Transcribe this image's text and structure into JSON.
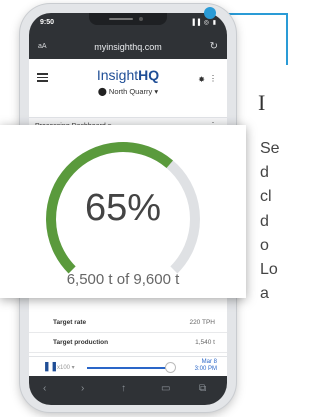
{
  "status_bar": {
    "time": "9:50",
    "icons": "▐▐ ◎ ▮"
  },
  "browser": {
    "text_size_label": "aA",
    "url": "myinsighthq.com",
    "reload_icon": "reload-icon"
  },
  "app": {
    "brand_plain": "Insight",
    "brand_bold": "HQ",
    "location": "North Quarry",
    "menu_icon": "hamburger-menu-icon",
    "bug_icon": "bug-icon"
  },
  "dashboard": {
    "title": "Processing Dashboard ▾",
    "more": "⋮"
  },
  "metrics": [
    {
      "label": "Target rate",
      "value": "220 TPH"
    },
    {
      "label": "Target production",
      "value": "1,540 t"
    }
  ],
  "playback": {
    "speed": "x100 ▾",
    "date": "Mar 8",
    "time": "3:00 PM",
    "progress": 0.95
  },
  "gauge": {
    "percent_label": "65%",
    "detail_label": "6,500 t of 9,600 t",
    "fraction": 0.65,
    "color_fill": "#5a9a3c",
    "color_track": "#dfe1e4"
  },
  "side_text": {
    "heading": "I",
    "lines": [
      "Se",
      "d",
      "cl",
      "d",
      "o",
      "Lo",
      "a"
    ]
  },
  "colors": {
    "accent": "#2a9bd6",
    "brand": "#1f4e96"
  }
}
